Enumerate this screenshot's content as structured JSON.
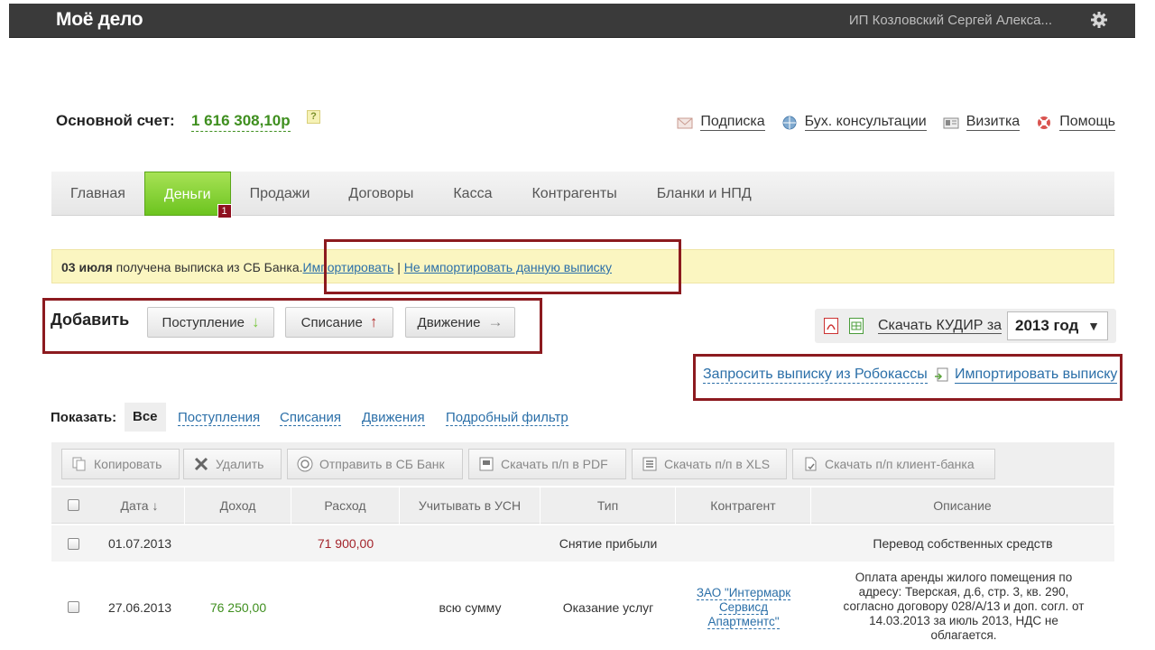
{
  "app": {
    "logo": "Моё дело",
    "user": "ИП Козловский Сергей Алекса..."
  },
  "account": {
    "label": "Основной счет:",
    "value": "1 616 308,10р",
    "help": "?"
  },
  "top_links": [
    {
      "label": "Подписка",
      "icon": "envelope-icon"
    },
    {
      "label": "Бух. консультации",
      "icon": "globe-icon"
    },
    {
      "label": "Визитка",
      "icon": "card-icon"
    },
    {
      "label": "Помощь",
      "icon": "lifebuoy-icon"
    }
  ],
  "nav": {
    "items": [
      "Главная",
      "Деньги",
      "Продажи",
      "Договоры",
      "Касса",
      "Контрагенты",
      "Бланки и НПД"
    ],
    "active": "Деньги",
    "badge": "1"
  },
  "notice": {
    "date": "03 июля",
    "text": " получена выписка из СБ Банка.",
    "import": "Импортировать",
    "separator": " | ",
    "no_import": "Не импортировать данную выписку"
  },
  "add": {
    "label": "Добавить",
    "buttons": [
      {
        "label": "Поступление",
        "arrow": "↓"
      },
      {
        "label": "Списание",
        "arrow": "↑"
      },
      {
        "label": "Движение",
        "arrow": "→"
      }
    ]
  },
  "kudir": {
    "link": "Скачать КУДИР за",
    "year": "2013 год",
    "caret": "▼"
  },
  "statements": {
    "robokassa": "Запросить выписку из Робокассы",
    "import": "Импортировать выписку"
  },
  "filter": {
    "label": "Показать:",
    "all": "Все",
    "links": [
      "Поступления",
      "Списания",
      "Движения",
      "Подробный фильтр"
    ]
  },
  "toolbar": [
    "Копировать",
    "Удалить",
    "Отправить в СБ Банк",
    "Скачать п/п в PDF",
    "Скачать п/п в XLS",
    "Скачать п/п клиент-банка"
  ],
  "table": {
    "headers": [
      "Дата ↓",
      "Доход",
      "Расход",
      "Учитывать в УСН",
      "Тип",
      "Контрагент",
      "Описание"
    ],
    "rows": [
      {
        "date": "01.07.2013",
        "income": "",
        "expense": "71 900,00",
        "usn": "",
        "type": "Снятие прибыли",
        "counterparty": "",
        "description": "Перевод собственных средств"
      },
      {
        "date": "27.06.2013",
        "income": "76 250,00",
        "expense": "",
        "usn": "всю сумму",
        "type": "Оказание услуг",
        "counterparty": "ЗАО \"Интермарк Сервисд Апартментс\"",
        "description": "Оплата аренды жилого помещения по адресу: Тверская, д.6, стр. 3, кв. 290, согласно договору 028/А/13 и доп. согл. от 14.03.2013 за июль 2013, НДС не облагается."
      }
    ]
  }
}
